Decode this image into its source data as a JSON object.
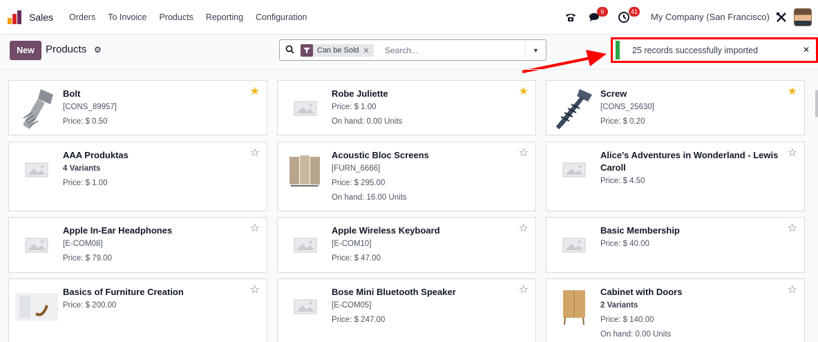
{
  "nav": {
    "brand": "Sales",
    "menu": [
      "Orders",
      "To Invoice",
      "Products",
      "Reporting",
      "Configuration"
    ],
    "messages_badge": "6",
    "activities_badge": "41",
    "company": "My Company (San Francisco)"
  },
  "control": {
    "new_label": "New",
    "title": "Products",
    "facet": "Can be Sold",
    "search_placeholder": "Search..."
  },
  "toast": {
    "message": "25 records successfully imported"
  },
  "colors": {
    "brand": "#714b67",
    "star": "#f3b61f",
    "success": "#28a745",
    "highlight": "#ff0000"
  },
  "products": [
    {
      "name": "Bolt",
      "lines": [
        "[CONS_89957]",
        "Price: $ 0.50"
      ],
      "favorite": true,
      "image": "bolt"
    },
    {
      "name": "Robe Juliette",
      "lines": [
        "Price: $ 1.00",
        "On hand: 0.00 Units"
      ],
      "favorite": true,
      "image": "placeholder"
    },
    {
      "name": "Screw",
      "lines": [
        "[CONS_25630]",
        "Price: $ 0.20"
      ],
      "favorite": true,
      "image": "screw"
    },
    {
      "name": "AAA Produktas",
      "lines": [
        "4 Variants",
        "Price: $ 1.00"
      ],
      "bold_first": true,
      "favorite": false,
      "image": "placeholder"
    },
    {
      "name": "Acoustic Bloc Screens",
      "lines": [
        "[FURN_6666]",
        "Price: $ 295.00",
        "On hand: 16.00 Units"
      ],
      "favorite": false,
      "image": "screens"
    },
    {
      "name": "Alice's Adventures in Wonderland - Lewis Caroll",
      "lines": [
        "Price: $ 4.50"
      ],
      "favorite": false,
      "image": "placeholder"
    },
    {
      "name": "Apple In-Ear Headphones",
      "lines": [
        "[E-COM08]",
        "Price: $ 79.00"
      ],
      "favorite": false,
      "image": "placeholder"
    },
    {
      "name": "Apple Wireless Keyboard",
      "lines": [
        "[E-COM10]",
        "Price: $ 47.00"
      ],
      "favorite": false,
      "image": "placeholder"
    },
    {
      "name": "Basic Membership",
      "lines": [
        "Price: $ 40.00"
      ],
      "favorite": false,
      "image": "placeholder"
    },
    {
      "name": "Basics of Furniture Creation",
      "lines": [
        "Price: $ 200.00"
      ],
      "favorite": false,
      "image": "furniture"
    },
    {
      "name": "Bose Mini Bluetooth Speaker",
      "lines": [
        "[E-COM05]",
        "Price: $ 247.00"
      ],
      "favorite": false,
      "image": "placeholder"
    },
    {
      "name": "Cabinet with Doors",
      "lines": [
        "2 Variants",
        "Price: $ 140.00",
        "On hand: 0.00 Units"
      ],
      "bold_first": true,
      "favorite": false,
      "image": "cabinet"
    }
  ]
}
